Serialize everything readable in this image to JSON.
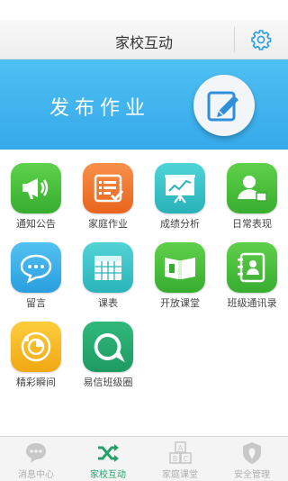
{
  "header": {
    "title": "家校互动"
  },
  "banner": {
    "text": "发布作业"
  },
  "apps": [
    {
      "label": "通知公告",
      "icon": "megaphone-icon",
      "color": "#46c13c"
    },
    {
      "label": "家庭作业",
      "icon": "homework-list-icon",
      "color": "#f37a2f"
    },
    {
      "label": "成绩分析",
      "icon": "presentation-chart-icon",
      "color": "#37c3c7"
    },
    {
      "label": "日常表现",
      "icon": "person-badge-icon",
      "color": "#4cc13f"
    },
    {
      "label": "留言",
      "icon": "chat-bubble-icon",
      "color": "#39aee8"
    },
    {
      "label": "课表",
      "icon": "timetable-grid-icon",
      "color": "#38c4c7"
    },
    {
      "label": "开放课堂",
      "icon": "open-book-icon",
      "color": "#4cbf3d"
    },
    {
      "label": "班级通讯录",
      "icon": "address-book-icon",
      "color": "#47c23e"
    },
    {
      "label": "精彩瞬间",
      "icon": "moments-icon",
      "color": "#f6bd22"
    },
    {
      "label": "易信班级圈",
      "icon": "yixin-circle-icon",
      "color": "#24a970"
    }
  ],
  "tabs": [
    {
      "label": "消息中心",
      "icon": "message-bubble-icon",
      "active": false
    },
    {
      "label": "家校互动",
      "icon": "shuffle-icon",
      "active": true
    },
    {
      "label": "家庭课堂",
      "icon": "abc-blocks-icon",
      "active": false
    },
    {
      "label": "安全管理",
      "icon": "shield-icon",
      "active": false
    }
  ],
  "colors": {
    "banner": "#42b6ee",
    "accent": "#26a06a",
    "settings": "#2a9de0"
  }
}
